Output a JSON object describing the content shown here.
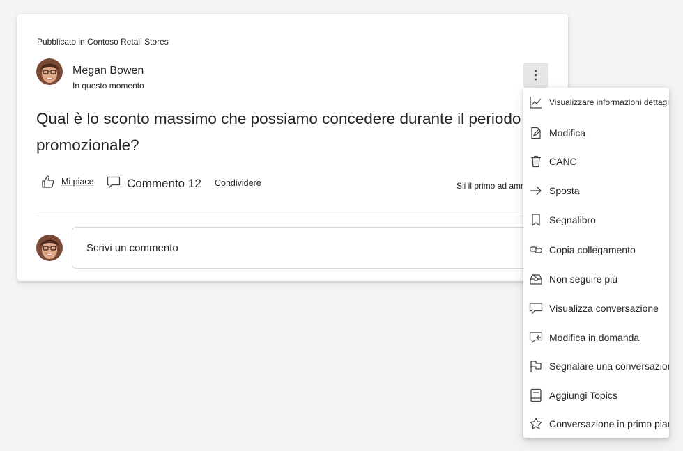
{
  "post": {
    "posted_in": "Pubblicato in Contoso Retail Stores",
    "author_name": "Megan Bowen",
    "time": "In questo momento",
    "question": "Qual è lo sconto massimo che possiamo concedere durante il periodo promozionale?",
    "more_icon": "more-vertical-icon"
  },
  "actions": {
    "like_label": "Mi piace",
    "comment_label": "Commento 12",
    "share_label": "Condividere",
    "first_like": "Sii il primo ad ammalati"
  },
  "comment_box": {
    "placeholder": "Scrivi un commento"
  },
  "menu": {
    "items": [
      {
        "label": "Visualizzare informazioni dettagliate",
        "icon": "chart-icon"
      },
      {
        "label": "Modifica",
        "icon": "edit-icon"
      },
      {
        "label": "CANC",
        "icon": "trash-icon"
      },
      {
        "label": "Sposta",
        "icon": "arrow-right-icon"
      },
      {
        "label": "Segnalibro",
        "icon": "bookmark-icon"
      },
      {
        "label": "Copia collegamento",
        "icon": "link-icon"
      },
      {
        "label": "Non seguire più",
        "icon": "unfollow-icon"
      },
      {
        "label": "Visualizza conversazione",
        "icon": "conversation-icon"
      },
      {
        "label": "Modifica in domanda",
        "icon": "convert-question-icon"
      },
      {
        "label": "Segnalare una conversazione",
        "icon": "flag-icon"
      },
      {
        "label": "Aggiungi Topics",
        "icon": "topics-icon"
      },
      {
        "label": "Conversazione in primo piano",
        "icon": "star-icon"
      }
    ]
  },
  "colors": {
    "background": "#f5f4f3",
    "card": "#ffffff",
    "text": "#242424",
    "more_button_bg": "#e6e6e6"
  }
}
